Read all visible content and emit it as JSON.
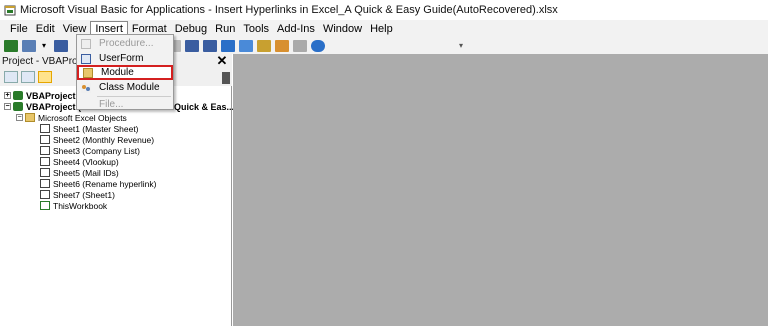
{
  "window": {
    "title": "Microsoft Visual Basic for Applications - Insert Hyperlinks in Excel_A Quick & Easy Guide(AutoRecovered).xlsx"
  },
  "menubar": {
    "items": [
      "File",
      "Edit",
      "View",
      "Insert",
      "Format",
      "Debug",
      "Run",
      "Tools",
      "Add-Ins",
      "Window",
      "Help"
    ],
    "active": "Insert"
  },
  "insert_menu": {
    "items": [
      {
        "label": "Procedure...",
        "enabled": false,
        "icon": "procedure-icon"
      },
      {
        "label": "UserForm",
        "enabled": true,
        "icon": "userform-icon"
      },
      {
        "label": "Module",
        "enabled": true,
        "icon": "module-icon",
        "highlighted": true
      },
      {
        "label": "Class Module",
        "enabled": true,
        "icon": "class-module-icon"
      },
      {
        "label": "File...",
        "enabled": false,
        "icon": ""
      }
    ]
  },
  "project_pane": {
    "title": "Project - VBAProject",
    "close_glyph": "✕",
    "tree": [
      {
        "label": "VBAProject (P",
        "bold": true,
        "expander": "+",
        "icon": "vba-project-icon"
      },
      {
        "label": "VBAProject (I",
        "suffix": "Quick & Eas...)",
        "bold": true,
        "expander": "−",
        "icon": "vba-project-icon"
      },
      {
        "label": "Microsoft Excel Objects",
        "bold": false,
        "expander": "−",
        "icon": "folder-icon"
      },
      {
        "label": "Sheet1 (Master Sheet)",
        "icon": "sheet-icon"
      },
      {
        "label": "Sheet2 (Monthly Revenue)",
        "icon": "sheet-icon"
      },
      {
        "label": "Sheet3 (Company List)",
        "icon": "sheet-icon"
      },
      {
        "label": "Sheet4 (Vlookup)",
        "icon": "sheet-icon"
      },
      {
        "label": "Sheet5 (Mail IDs)",
        "icon": "sheet-icon"
      },
      {
        "label": "Sheet6 (Rename hyperlink)",
        "icon": "sheet-icon"
      },
      {
        "label": "Sheet7 (Sheet1)",
        "icon": "sheet-icon"
      },
      {
        "label": "ThisWorkbook",
        "icon": "workbook-icon"
      }
    ]
  },
  "colors": {
    "workarea": "#acacac",
    "highlight_border": "#d42020"
  }
}
